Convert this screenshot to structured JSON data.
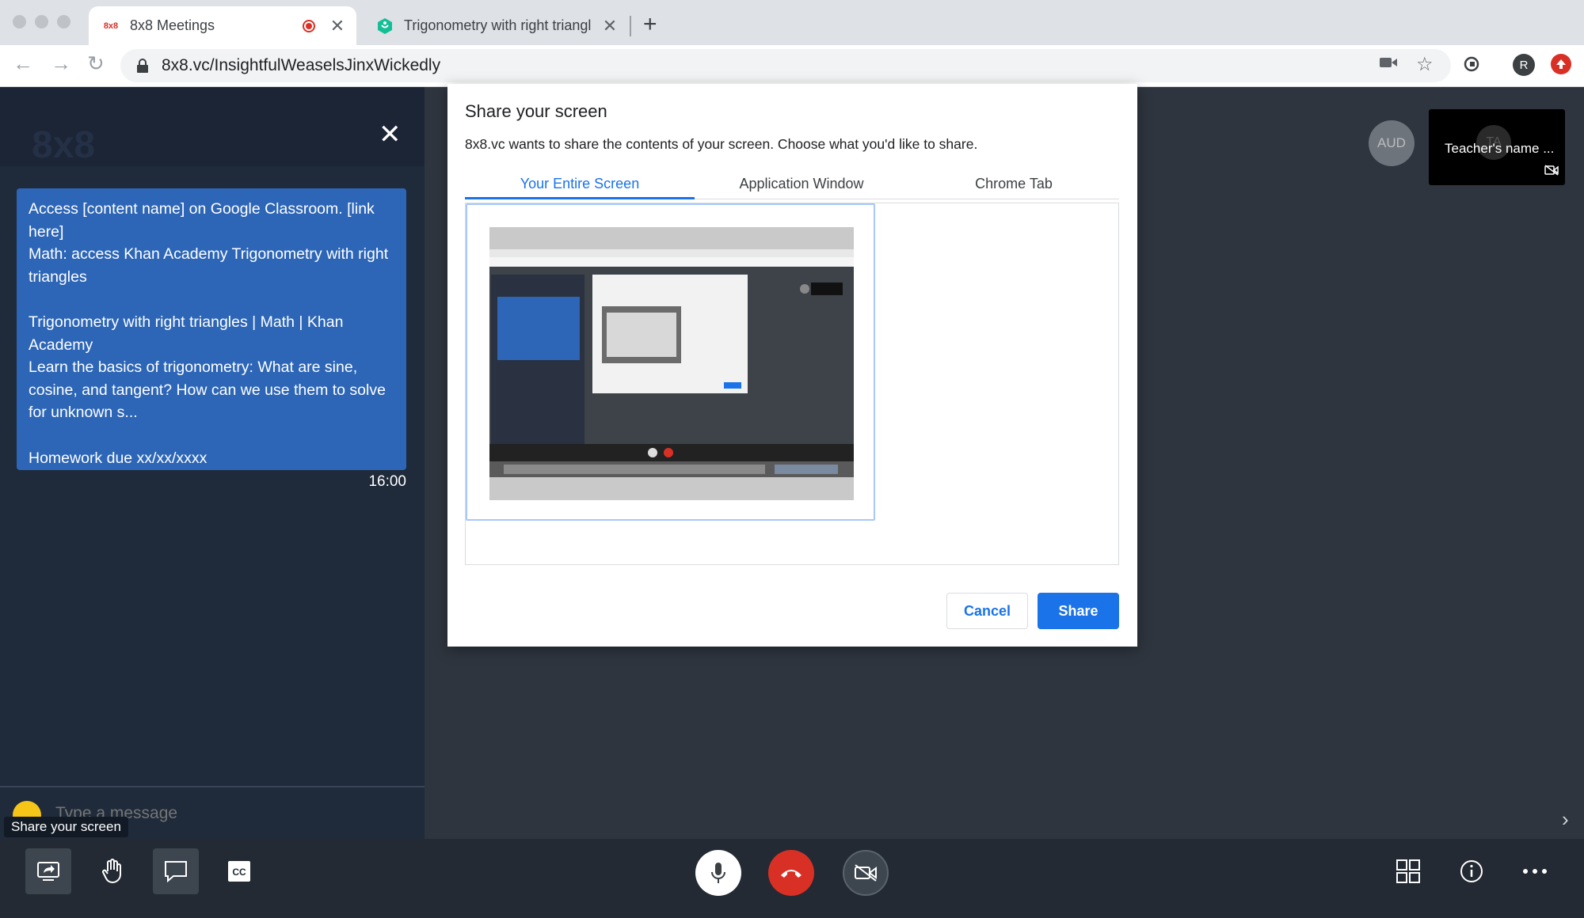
{
  "browser": {
    "tabs": [
      {
        "favicon_text": "8x8",
        "title": "8x8 Meetings",
        "active": true
      },
      {
        "title": "Trigonometry with right triangl",
        "active": false
      }
    ],
    "new_tab": "+",
    "url_host": "8x8.vc",
    "url_path": "/InsightfulWeaselsJinxWickedly",
    "profile_initial": "R"
  },
  "chat": {
    "logo": "8x8",
    "close": "✕",
    "message": "Access [content name] on Google Classroom. [link here]\nMath: access Khan Academy Trigonometry with right triangles\n\nTrigonometry with right triangles | Math | Khan Academy\nLearn the basics of trigonometry: What are sine, cosine, and tangent? How can we use them to solve for unknown s...\n\nHomework due xx/xx/xxxx",
    "time": "16:00",
    "input_placeholder": "Type a message",
    "tooltip": "Share your screen"
  },
  "participants": {
    "audience_label": "AUD",
    "thumb_name": "Teacher's name ...",
    "thumb_initials": "TA"
  },
  "modal": {
    "title": "Share your screen",
    "description": "8x8.vc wants to share the contents of your screen. Choose what you'd like to share.",
    "tabs": [
      "Your Entire Screen",
      "Application Window",
      "Chrome Tab"
    ],
    "cancel": "Cancel",
    "share": "Share"
  },
  "icons": {
    "back": "back-icon",
    "forward": "forward-icon",
    "reload": "reload-icon",
    "camera": "camera-icon",
    "star": "star-icon",
    "extension": "extension-icon"
  },
  "colors": {
    "accent": "#1a73e8",
    "hangup": "#d93025",
    "chat_bubble": "#2d66b7"
  }
}
